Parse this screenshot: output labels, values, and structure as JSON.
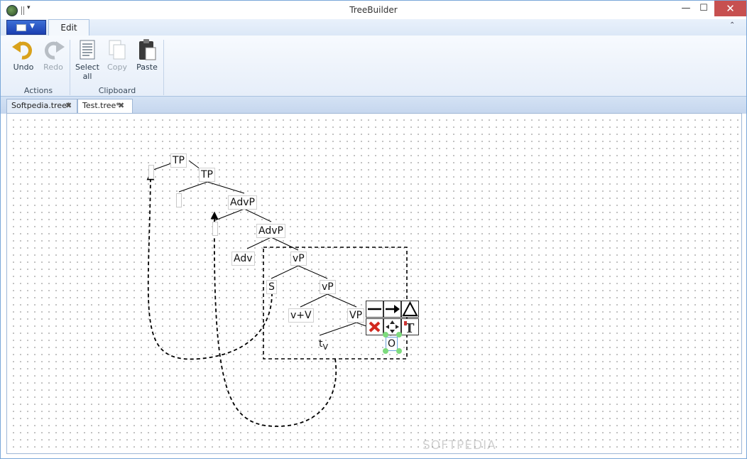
{
  "window": {
    "title": "TreeBuilder"
  },
  "ribbon": {
    "active_tab": "Edit",
    "groups": [
      {
        "label": "Actions",
        "buttons": [
          {
            "label": "Undo",
            "enabled": true,
            "icon": "undo-icon"
          },
          {
            "label": "Redo",
            "enabled": false,
            "icon": "redo-icon"
          }
        ]
      },
      {
        "label": "Clipboard",
        "buttons": [
          {
            "label": "Select all",
            "enabled": true,
            "icon": "select-all-icon"
          },
          {
            "label": "Copy",
            "enabled": false,
            "icon": "copy-icon"
          },
          {
            "label": "Paste",
            "enabled": true,
            "icon": "paste-icon"
          }
        ]
      }
    ]
  },
  "documents": [
    {
      "name": "Softpedia.tree*",
      "active": false
    },
    {
      "name": "Test.tree*",
      "active": true
    }
  ],
  "tree": {
    "nodes": {
      "tp1": "TP",
      "tp2": "TP",
      "advp1": "AdvP",
      "advp2": "AdvP",
      "adv": "Adv",
      "vp1": "vP",
      "s": "S",
      "vp2": "vP",
      "vv": "v+V",
      "vp3": "VP",
      "tv": "t",
      "tv_sub": "V",
      "o": "O"
    }
  },
  "context_toolbar": [
    "line-tool-icon",
    "arrow-tool-icon",
    "triangle-tool-icon",
    "delete-icon",
    "move-icon",
    "text-format-icon"
  ],
  "watermark": "SOFTPEDIA"
}
